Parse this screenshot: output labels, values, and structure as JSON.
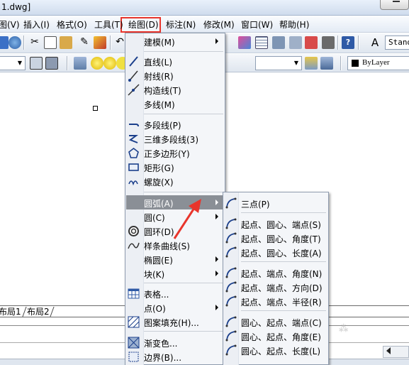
{
  "window": {
    "title": "1.dwg]"
  },
  "menubar": {
    "items": [
      "图(V)",
      "插入(I)",
      "格式(O)",
      "工具(T)",
      "绘图(D)",
      "标注(N)",
      "修改(M)",
      "窗口(W)",
      "帮助(H)"
    ]
  },
  "toolbar": {
    "style_combo": "Stand",
    "layer_combo": "ByLayer"
  },
  "layout_tabs": [
    "布局1",
    "布局2"
  ],
  "draw_menu": {
    "items": [
      {
        "label": "建模(M)",
        "submenu": true,
        "icon": ""
      },
      {
        "label": "直线(L)",
        "icon": "line-icon"
      },
      {
        "label": "射线(R)",
        "icon": "ray-icon"
      },
      {
        "label": "构造线(T)",
        "icon": "construction-line-icon"
      },
      {
        "label": "多线(M)",
        "icon": ""
      },
      {
        "label": "多段线(P)",
        "icon": "polyline-icon"
      },
      {
        "label": "三维多段线(3)",
        "icon": "3d-polyline-icon"
      },
      {
        "label": "正多边形(Y)",
        "icon": "polygon-icon"
      },
      {
        "label": "矩形(G)",
        "icon": "rectangle-icon"
      },
      {
        "label": "螺旋(X)",
        "icon": "helix-icon"
      },
      {
        "label": "圆弧(A)",
        "submenu": true,
        "icon": "",
        "highlighted": true
      },
      {
        "label": "圆(C)",
        "submenu": true,
        "icon": ""
      },
      {
        "label": "圆环(D)",
        "icon": "donut-icon"
      },
      {
        "label": "样条曲线(S)",
        "icon": "spline-icon"
      },
      {
        "label": "椭圆(E)",
        "submenu": true,
        "icon": ""
      },
      {
        "label": "块(K)",
        "submenu": true,
        "icon": ""
      },
      {
        "label": "表格...",
        "icon": "table-icon"
      },
      {
        "label": "点(O)",
        "submenu": true,
        "icon": ""
      },
      {
        "label": "图案填充(H)...",
        "icon": "hatch-icon"
      },
      {
        "label": "渐变色...",
        "icon": "gradient-icon"
      },
      {
        "label": "边界(B)...",
        "icon": "boundary-icon"
      }
    ]
  },
  "arc_menu": {
    "items": [
      "三点(P)",
      "起点、圆心、端点(S)",
      "起点、圆心、角度(T)",
      "起点、圆心、长度(A)",
      "起点、端点、角度(N)",
      "起点、端点、方向(D)",
      "起点、端点、半径(R)",
      "圆心、起点、端点(C)",
      "圆心、起点、角度(E)",
      "圆心、起点、长度(L)"
    ]
  },
  "colors": {
    "highlight_box": "#e8352c",
    "arrow": "#e8352c",
    "menu_bg": "#f4f6f9",
    "selected_row": "#8a8f96"
  }
}
